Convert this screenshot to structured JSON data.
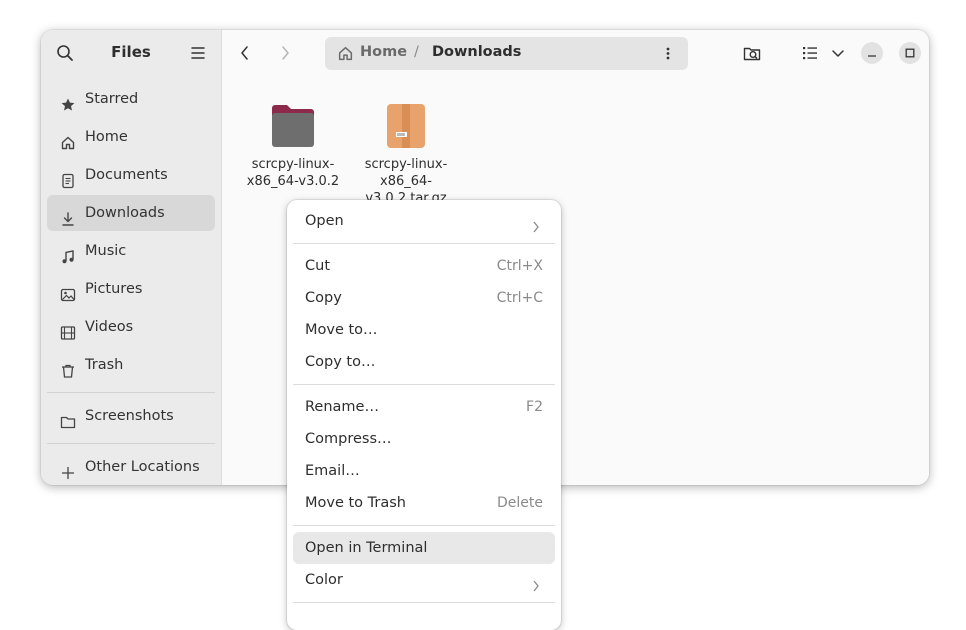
{
  "sidebar": {
    "title": "Files",
    "items": [
      {
        "label": "Starred",
        "icon": "star-icon"
      },
      {
        "label": "Home",
        "icon": "home-icon"
      },
      {
        "label": "Documents",
        "icon": "document-icon"
      },
      {
        "label": "Downloads",
        "icon": "download-icon"
      },
      {
        "label": "Music",
        "icon": "music-icon"
      },
      {
        "label": "Pictures",
        "icon": "picture-icon"
      },
      {
        "label": "Videos",
        "icon": "video-icon"
      },
      {
        "label": "Trash",
        "icon": "trash-icon"
      }
    ],
    "bookmarks": [
      {
        "label": "Screenshots",
        "icon": "folder-icon"
      }
    ],
    "other_locations": {
      "label": "Other Locations",
      "icon": "plus-icon"
    }
  },
  "pathbar": {
    "home": "Home",
    "separator": "/",
    "current": "Downloads"
  },
  "files": [
    {
      "name": "scrcpy-linux-x86_64-v3.0.2",
      "type": "folder",
      "accent_color": "#8b2a4a"
    },
    {
      "name": "scrcpy-linux-x86_64-v3.0.2.tar.gz",
      "type": "archive",
      "accent_color": "#e8a36c"
    }
  ],
  "context_menu": {
    "items": [
      {
        "label": "Open",
        "accel": "",
        "submenu": true
      },
      {
        "label": "Cut",
        "accel": "Ctrl+X"
      },
      {
        "label": "Copy",
        "accel": "Ctrl+C"
      },
      {
        "label": "Move to…",
        "accel": ""
      },
      {
        "label": "Copy to…",
        "accel": ""
      },
      {
        "label": "Rename…",
        "accel": "F2"
      },
      {
        "label": "Compress…",
        "accel": ""
      },
      {
        "label": "Email…",
        "accel": ""
      },
      {
        "label": "Move to Trash",
        "accel": "Delete"
      },
      {
        "label": "Open in Terminal",
        "accel": "",
        "highlighted": true
      },
      {
        "label": "Color",
        "accel": "",
        "submenu": true
      }
    ]
  },
  "colors": {
    "sidebar_bg": "#ebebeb",
    "selected_bg": "#d8d8d8",
    "menu_highlight": "#e8e8e8"
  }
}
